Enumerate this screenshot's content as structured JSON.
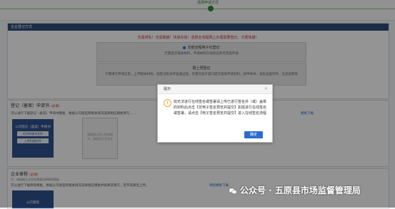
{
  "progress": {
    "step_label": "选择申请方式"
  },
  "company_registration": {
    "header": "企业登记方式",
    "slogan": "无需排队！无需跑腿！快速办结！选择全流程网上办理需要登记，方便快捷！",
    "option_full": {
      "title": "无纸全程电子化登记",
      "desc": "无需提交纸质材料，申请材料在线签名即可完成申请"
    },
    "option_online": {
      "title": "网上预登记",
      "desc": "只需填写申请信息，上传相关材料，经登记机关审查通过后，仍需向该于窗口提交纸质申请材料，如申请书、身份证复印件、信息说明等"
    }
  },
  "application_section": {
    "title": "登记（备案）申请书",
    "required": "(必填)",
    "desc": "可以进行下载登记（备案）申请书模板，根据公司类型和相关情况选择相应模板填写……",
    "download_link": "模板下载",
    "card_title": "公司登记（备案）申请书",
    "print_button": "打印申请书文件",
    "upload_button": "上传扫描文件",
    "upload_hint": "请按照示例上传申请书，请保证大写齐全"
  },
  "articles_section": {
    "title": "企业章程",
    "required": "(必填)",
    "note": "注：请根据企业实际需要选择章程模板",
    "desc": "可以进行下载章程模板，根据公司类型和相关情况选择相应模板并按要求填写，签字盖章后上传。",
    "link": "章程模板下载",
    "card_title": "公司章程"
  },
  "dialog": {
    "title": "提示",
    "message": "如无法进行在线签名或签署请上传已进行签名并（或）盖章的材料后点击【非电子签名预览并提交】如需进行在线签名或签署，请点击【电子签名预览并提交】进入在线签名流程",
    "ok_label": "确定",
    "close_icon": "close-icon",
    "warning_icon": "warning-icon"
  },
  "watermark": {
    "text": "公众号 · 五原县市场监督管理局"
  },
  "colors": {
    "header": "#2c4c7c",
    "accent": "#2a6bd1",
    "warning": "#f0a73a",
    "alert_text": "#cc3333"
  }
}
